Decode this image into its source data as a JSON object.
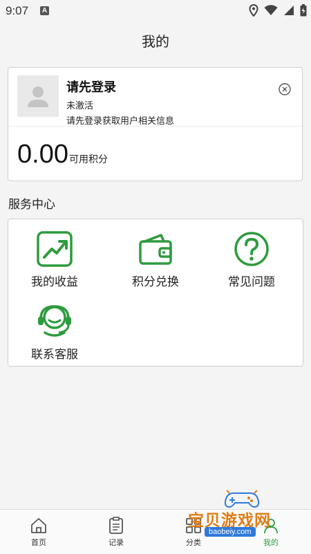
{
  "status_bar": {
    "time": "9:07",
    "notification_badge": "A",
    "icons": [
      "location-icon",
      "wifi-icon",
      "signal-icon",
      "battery-icon"
    ]
  },
  "page_title": "我的",
  "user_card": {
    "name": "请先登录",
    "status": "未激活",
    "hint": "请先登录获取用户相关信息",
    "points_value": "0.00",
    "points_label": "可用积分"
  },
  "services": {
    "title": "服务中心",
    "items": [
      {
        "label": "我的收益",
        "icon": "earnings-chart-icon"
      },
      {
        "label": "积分兑换",
        "icon": "wallet-icon"
      },
      {
        "label": "常见问题",
        "icon": "question-icon"
      },
      {
        "label": "联系客服",
        "icon": "headset-icon"
      }
    ]
  },
  "tab_bar": {
    "items": [
      {
        "label": "首页",
        "icon": "home-icon"
      },
      {
        "label": "记录",
        "icon": "record-icon"
      },
      {
        "label": "分类",
        "icon": "category-icon"
      },
      {
        "label": "我的",
        "icon": "profile-icon",
        "active": true
      }
    ]
  },
  "watermark": {
    "text": "宝贝游戏网",
    "url": "baobeiy.com"
  },
  "colors": {
    "accent_green": "#2e9b3e",
    "background": "#f4f4f4",
    "watermark_orange": "#e07d16",
    "watermark_blue": "#2e79d9"
  }
}
